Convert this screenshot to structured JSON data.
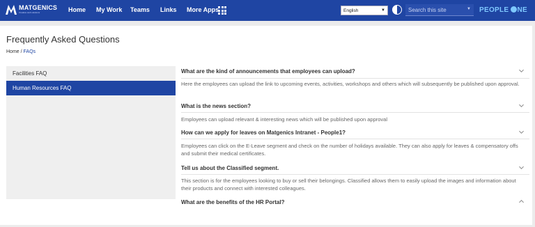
{
  "header": {
    "logo_name": "MATGENICS",
    "logo_tagline": "Creative web solutions",
    "nav": [
      "Home",
      "My Work",
      "Teams",
      "Links",
      "More Apps"
    ],
    "language": "English",
    "search_placeholder": "Search this site",
    "brand": [
      "PEOPLE",
      "NE"
    ]
  },
  "page": {
    "title": "Frequently Asked Questions",
    "breadcrumb": {
      "home": "Home",
      "sep": " / ",
      "current": "FAQs"
    }
  },
  "sidebar": {
    "items": [
      {
        "label": "Facilities FAQ",
        "active": false
      },
      {
        "label": "Human Resources FAQ",
        "active": true
      }
    ]
  },
  "faqs": [
    {
      "q": "What are the kind of announcements that employees can upload?",
      "a": "Here the employees can upload the link to upcoming events, activities, workshops and others which will subsequently be published upon approval.",
      "open": true
    },
    {
      "q": "What is the news section?",
      "a": "Employees can upload relevant & interesting news which will be published upon approval",
      "open": true
    },
    {
      "q": "How can we apply for leaves on Matgenics Intranet - People1?",
      "a": "Employees can click on the E-Leave segment and check on the number of holidays available. They can also apply for leaves & compensatory offs and submit their medical certificates.",
      "open": true
    },
    {
      "q": "Tell us about the Classified segment.",
      "a": "This section is for the employees looking to buy or sell their belongings. Classified allows them to easily upload the images and information about their products and connect with interested colleagues.",
      "open": true
    },
    {
      "q": "What are the benefits of the HR Portal?",
      "a": "",
      "open": false
    }
  ],
  "colors": {
    "header_bg": "#1f45a3",
    "active_bg": "#1f45a3",
    "brand": "#7ec8ff"
  }
}
